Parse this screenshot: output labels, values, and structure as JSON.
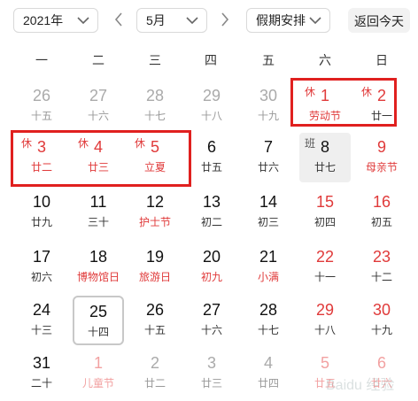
{
  "toolbar": {
    "year_value": "2021年",
    "month_value": "5月",
    "holiday_value": "假期安排",
    "today_label": "返回今天"
  },
  "weekdays": [
    "一",
    "二",
    "三",
    "四",
    "五",
    "六",
    "日"
  ],
  "tags": {
    "rest": "休",
    "work": "班"
  },
  "weeks": [
    [
      {
        "day": "26",
        "lunar": "十五",
        "style": "dim"
      },
      {
        "day": "27",
        "lunar": "十六",
        "style": "dim"
      },
      {
        "day": "28",
        "lunar": "十七",
        "style": "dim"
      },
      {
        "day": "29",
        "lunar": "十八",
        "style": "dim"
      },
      {
        "day": "30",
        "lunar": "十九",
        "style": "dim"
      },
      {
        "day": "1",
        "lunar": "劳动节",
        "style": "holiday",
        "tag": "rest"
      },
      {
        "day": "2",
        "lunar": "廿一",
        "style": "holiday-black",
        "tag": "rest"
      }
    ],
    [
      {
        "day": "3",
        "lunar": "廿二",
        "style": "holiday",
        "tag": "rest"
      },
      {
        "day": "4",
        "lunar": "廿三",
        "style": "holiday",
        "tag": "rest"
      },
      {
        "day": "5",
        "lunar": "立夏",
        "style": "holiday",
        "tag": "rest"
      },
      {
        "day": "6",
        "lunar": "廿五",
        "style": "normal"
      },
      {
        "day": "7",
        "lunar": "廿六",
        "style": "normal"
      },
      {
        "day": "8",
        "lunar": "廿七",
        "style": "work",
        "tag": "work"
      },
      {
        "day": "9",
        "lunar": "母亲节",
        "style": "weekend-red"
      }
    ],
    [
      {
        "day": "10",
        "lunar": "廿九",
        "style": "normal"
      },
      {
        "day": "11",
        "lunar": "三十",
        "style": "normal"
      },
      {
        "day": "12",
        "lunar": "护士节",
        "style": "redlunar"
      },
      {
        "day": "13",
        "lunar": "初二",
        "style": "normal"
      },
      {
        "day": "14",
        "lunar": "初三",
        "style": "normal"
      },
      {
        "day": "15",
        "lunar": "初四",
        "style": "weekend"
      },
      {
        "day": "16",
        "lunar": "初五",
        "style": "weekend"
      }
    ],
    [
      {
        "day": "17",
        "lunar": "初六",
        "style": "normal"
      },
      {
        "day": "18",
        "lunar": "博物馆日",
        "style": "redlunar"
      },
      {
        "day": "19",
        "lunar": "旅游日",
        "style": "redlunar"
      },
      {
        "day": "20",
        "lunar": "初九",
        "style": "redlunar"
      },
      {
        "day": "21",
        "lunar": "小满",
        "style": "redlunar"
      },
      {
        "day": "22",
        "lunar": "十一",
        "style": "weekend"
      },
      {
        "day": "23",
        "lunar": "十二",
        "style": "weekend"
      }
    ],
    [
      {
        "day": "24",
        "lunar": "十三",
        "style": "normal"
      },
      {
        "day": "25",
        "lunar": "十四",
        "style": "today"
      },
      {
        "day": "26",
        "lunar": "十五",
        "style": "normal"
      },
      {
        "day": "27",
        "lunar": "十六",
        "style": "normal"
      },
      {
        "day": "28",
        "lunar": "十七",
        "style": "normal"
      },
      {
        "day": "29",
        "lunar": "十八",
        "style": "weekend"
      },
      {
        "day": "30",
        "lunar": "十九",
        "style": "weekend"
      }
    ],
    [
      {
        "day": "31",
        "lunar": "二十",
        "style": "normal"
      },
      {
        "day": "1",
        "lunar": "儿童节",
        "style": "dimred"
      },
      {
        "day": "2",
        "lunar": "廿二",
        "style": "dim"
      },
      {
        "day": "3",
        "lunar": "廿三",
        "style": "dim"
      },
      {
        "day": "4",
        "lunar": "廿四",
        "style": "dim"
      },
      {
        "day": "5",
        "lunar": "廿五",
        "style": "dimred"
      },
      {
        "day": "6",
        "lunar": "廿六",
        "style": "dimred"
      }
    ]
  ],
  "colors": {
    "holiday_red": "#e03a3a",
    "highlight_box": "#e0201f",
    "work_bg": "#efefef"
  }
}
